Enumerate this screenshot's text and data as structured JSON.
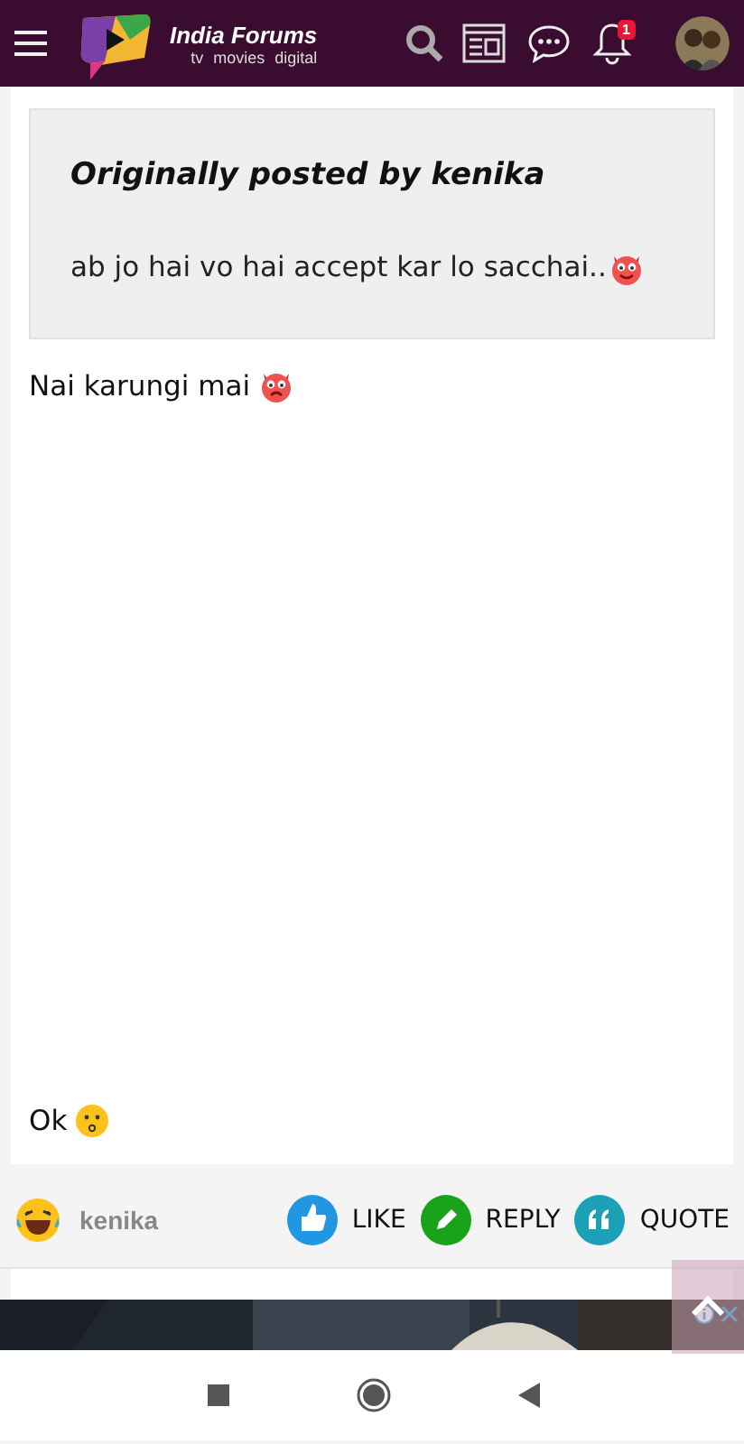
{
  "header": {
    "brand": "India Forums",
    "tagline": "tv movies digital",
    "notification_count": "1"
  },
  "post": {
    "quote": {
      "attribution": "Originally posted by kenika",
      "text": "ab jo hai vo hai accept kar lo sacchai.."
    },
    "reply_text": "Nai karungi mai",
    "closing_text": "Ok"
  },
  "footer": {
    "author": "kenika",
    "actions": [
      {
        "kind": "like",
        "label": "LIKE"
      },
      {
        "kind": "reply",
        "label": "REPLY"
      },
      {
        "kind": "quote",
        "label": "QUOTE"
      }
    ]
  }
}
